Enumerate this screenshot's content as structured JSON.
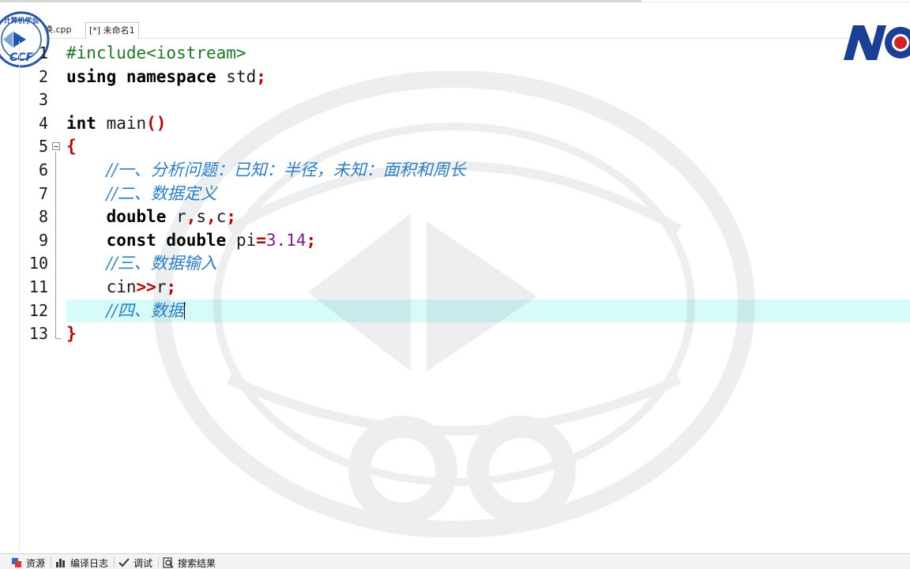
{
  "tabs": [
    {
      "label": "的交换.cpp",
      "active": false
    },
    {
      "label": "[*] 未命名1",
      "active": true
    }
  ],
  "logos": {
    "seal_text": "CCF",
    "seal_arc_text": "计算机学会",
    "noi_text": "NOI"
  },
  "editor": {
    "lines": [
      {
        "num": "1",
        "tokens": [
          {
            "t": "#include<iostream>",
            "c": "pp"
          }
        ]
      },
      {
        "num": "2",
        "tokens": [
          {
            "t": "using namespace",
            "c": "kw"
          },
          {
            "t": " std",
            "c": ""
          },
          {
            "t": ";",
            "c": "sym"
          }
        ]
      },
      {
        "num": "3",
        "tokens": []
      },
      {
        "num": "4",
        "tokens": [
          {
            "t": "int",
            "c": "kw"
          },
          {
            "t": " main",
            "c": ""
          },
          {
            "t": "()",
            "c": "sym"
          }
        ]
      },
      {
        "num": "5",
        "tokens": [
          {
            "t": "{",
            "c": "sym"
          }
        ]
      },
      {
        "num": "6",
        "tokens": [
          {
            "t": "    ",
            "c": ""
          },
          {
            "t": "//一、分析问题：已知：半径，未知：面积和周长",
            "c": "cmt"
          }
        ]
      },
      {
        "num": "7",
        "tokens": [
          {
            "t": "    ",
            "c": ""
          },
          {
            "t": "//二、数据定义",
            "c": "cmt"
          }
        ]
      },
      {
        "num": "8",
        "tokens": [
          {
            "t": "    ",
            "c": ""
          },
          {
            "t": "double",
            "c": "kw"
          },
          {
            "t": " r",
            "c": ""
          },
          {
            "t": ",",
            "c": "sym"
          },
          {
            "t": "s",
            "c": ""
          },
          {
            "t": ",",
            "c": "sym"
          },
          {
            "t": "c",
            "c": ""
          },
          {
            "t": ";",
            "c": "sym"
          }
        ]
      },
      {
        "num": "9",
        "tokens": [
          {
            "t": "    ",
            "c": ""
          },
          {
            "t": "const double",
            "c": "kw"
          },
          {
            "t": " pi",
            "c": ""
          },
          {
            "t": "=",
            "c": "sym"
          },
          {
            "t": "3.14",
            "c": "num"
          },
          {
            "t": ";",
            "c": "sym"
          }
        ]
      },
      {
        "num": "10",
        "tokens": [
          {
            "t": "    ",
            "c": ""
          },
          {
            "t": "//三、数据输入",
            "c": "cmt"
          }
        ]
      },
      {
        "num": "11",
        "tokens": [
          {
            "t": "    ",
            "c": ""
          },
          {
            "t": "cin",
            "c": ""
          },
          {
            "t": ">>",
            "c": "sym"
          },
          {
            "t": "r",
            "c": ""
          },
          {
            "t": ";",
            "c": "sym"
          }
        ]
      },
      {
        "num": "12",
        "tokens": [
          {
            "t": "    ",
            "c": ""
          },
          {
            "t": "//四、数据",
            "c": "cmt"
          }
        ],
        "caret": true,
        "current": true
      },
      {
        "num": "13",
        "tokens": [
          {
            "t": "}",
            "c": "sym"
          }
        ]
      }
    ]
  },
  "bottom_bar": {
    "items": [
      {
        "label": "资源",
        "icon": "resources-icon"
      },
      {
        "label": "编译日志",
        "icon": "compile-log-icon"
      },
      {
        "label": "调试",
        "icon": "debug-check-icon"
      },
      {
        "label": "搜索结果",
        "icon": "search-results-icon"
      }
    ]
  },
  "colors": {
    "keyword": "#000000",
    "preprocessor": "#1f7a24",
    "symbol": "#c00000",
    "number": "#7a1d8c",
    "comment": "#2a7fc7",
    "current_line": "#d6fbf9",
    "noi_blue": "#1c3f96",
    "noi_red": "#d42027"
  }
}
